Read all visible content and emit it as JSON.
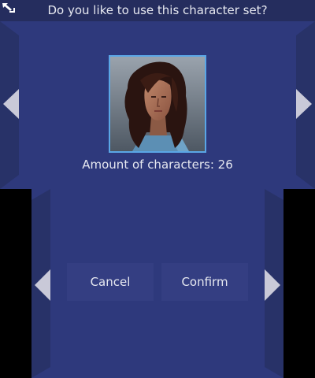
{
  "header": {
    "title": "Do you like to use this character set?",
    "back_icon": "back-arrow-icon"
  },
  "preview": {
    "portrait_icon": "character-portrait",
    "count_label": "Amount of characters: 26"
  },
  "navigation": {
    "prev_icon": "triangle-left-icon",
    "next_icon": "triangle-right-icon"
  },
  "actions": {
    "cancel_label": "Cancel",
    "confirm_label": "Confirm"
  },
  "colors": {
    "background": "#2e397c",
    "title_bar": "#252d5e",
    "panel": "#283268",
    "button": "#343e82",
    "arrow": "#c9c9d8",
    "frame": "#5aa6e6",
    "text": "#e6e8f0"
  }
}
